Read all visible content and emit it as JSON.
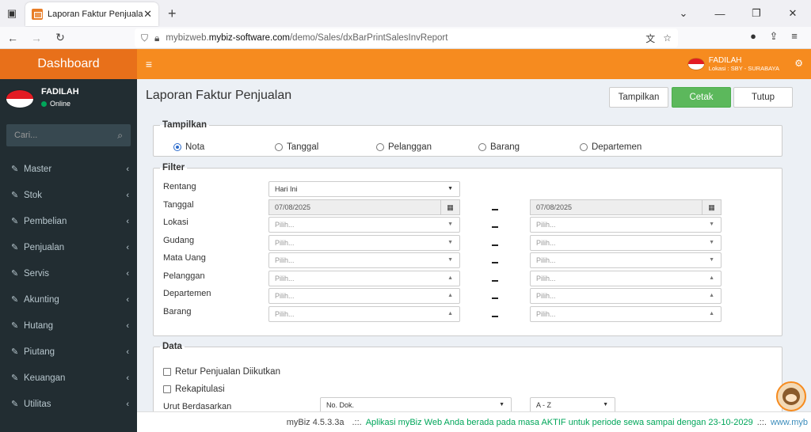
{
  "browser": {
    "tab_title": "Laporan Faktur Penjualan",
    "url_host": "mybizweb.",
    "url_domain": "mybiz-software.com",
    "url_path": "/demo/Sales/dxBarPrintSalesInvReport"
  },
  "sidebar": {
    "brand": "Dashboard",
    "user_name": "FADILAH",
    "user_status": "Online",
    "search_placeholder": "Cari...",
    "items": [
      {
        "label": "Master"
      },
      {
        "label": "Stok"
      },
      {
        "label": "Pembelian"
      },
      {
        "label": "Penjualan"
      },
      {
        "label": "Servis"
      },
      {
        "label": "Akunting"
      },
      {
        "label": "Hutang"
      },
      {
        "label": "Piutang"
      },
      {
        "label": "Keuangan"
      },
      {
        "label": "Utilitas"
      }
    ]
  },
  "topbar": {
    "user_name": "FADILAH",
    "location": "Lokasi : SBY - SURABAYA"
  },
  "page": {
    "title": "Laporan Faktur Penjualan",
    "buttons": {
      "tampilkan": "Tampilkan",
      "cetak": "Cetak",
      "tutup": "Tutup"
    }
  },
  "tampilkan": {
    "legend": "Tampilkan",
    "options": [
      {
        "label": "Nota",
        "checked": true
      },
      {
        "label": "Tanggal",
        "checked": false
      },
      {
        "label": "Pelanggan",
        "checked": false
      },
      {
        "label": "Barang",
        "checked": false
      },
      {
        "label": "Departemen",
        "checked": false
      }
    ]
  },
  "filter": {
    "legend": "Filter",
    "rentang_label": "Rentang",
    "rentang_value": "Hari Ini",
    "tanggal_label": "Tanggal",
    "tanggal_from": "07/08/2025",
    "tanggal_to": "07/08/2025",
    "rows": [
      {
        "label": "Lokasi",
        "from": "Pilih...",
        "to": "Pilih..."
      },
      {
        "label": "Gudang",
        "from": "Pilih...",
        "to": "Pilih..."
      },
      {
        "label": "Mata Uang",
        "from": "Pilih...",
        "to": "Pilih..."
      },
      {
        "label": "Pelanggan",
        "from": "Pilih...",
        "to": "Pilih..."
      },
      {
        "label": "Departemen",
        "from": "Pilih...",
        "to": "Pilih..."
      },
      {
        "label": "Barang",
        "from": "Pilih...",
        "to": "Pilih..."
      }
    ]
  },
  "data": {
    "legend": "Data",
    "retur_label": "Retur Penjualan Diikutkan",
    "rekap_label": "Rekapitulasi",
    "urut_label": "Urut Berdasarkan",
    "urut_value": "No. Dok.",
    "order_value": "A - Z"
  },
  "footer": {
    "version": "myBiz 4.5.3.3a",
    "sep": ".::.",
    "message": "Aplikasi myBiz Web Anda berada pada masa AKTIF untuk periode sewa sampai dengan 23-10-2029",
    "link": "www.myb"
  }
}
